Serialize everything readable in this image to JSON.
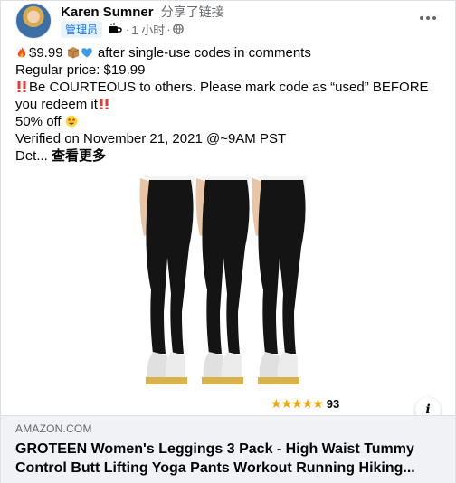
{
  "post": {
    "author_name": "Karen Sumner",
    "shared_text": "分享了链接",
    "role_badge": "管理员",
    "time": "1 小时",
    "separator": "·",
    "message": {
      "line1_text": "$9.99",
      "line1_suffix": " after single-use codes in comments",
      "line2": "Regular price: $19.99",
      "line3_text": "Be COURTEOUS to others. Please mark code as “used” BEFORE you redeem it",
      "line4_text": "50% off",
      "line5": "Verified on November 21, 2021 @~9AM PST",
      "line6_text": "Det...",
      "see_more": "查看更多"
    }
  },
  "link_card": {
    "domain": "AMAZON.COM",
    "title": "GROTEEN Women's Leggings 3 Pack - High Waist Tummy Control Butt Lifting Yoga Pants Workout Running Hiking...",
    "rating_stars": "★★★★★",
    "rating_count": "93",
    "info_label": "i"
  },
  "icons": [
    "more-options-icon",
    "coffee-icon",
    "globe-icon",
    "fire-emoji",
    "package-emoji",
    "blue-heart-emoji",
    "double-exclamation-emoji",
    "star-struck-emoji",
    "info-icon"
  ],
  "colors": {
    "accent": "#1877f2",
    "secondary_text": "#65676b",
    "card_bg": "#f0f2f5",
    "star": "#f0a500"
  }
}
